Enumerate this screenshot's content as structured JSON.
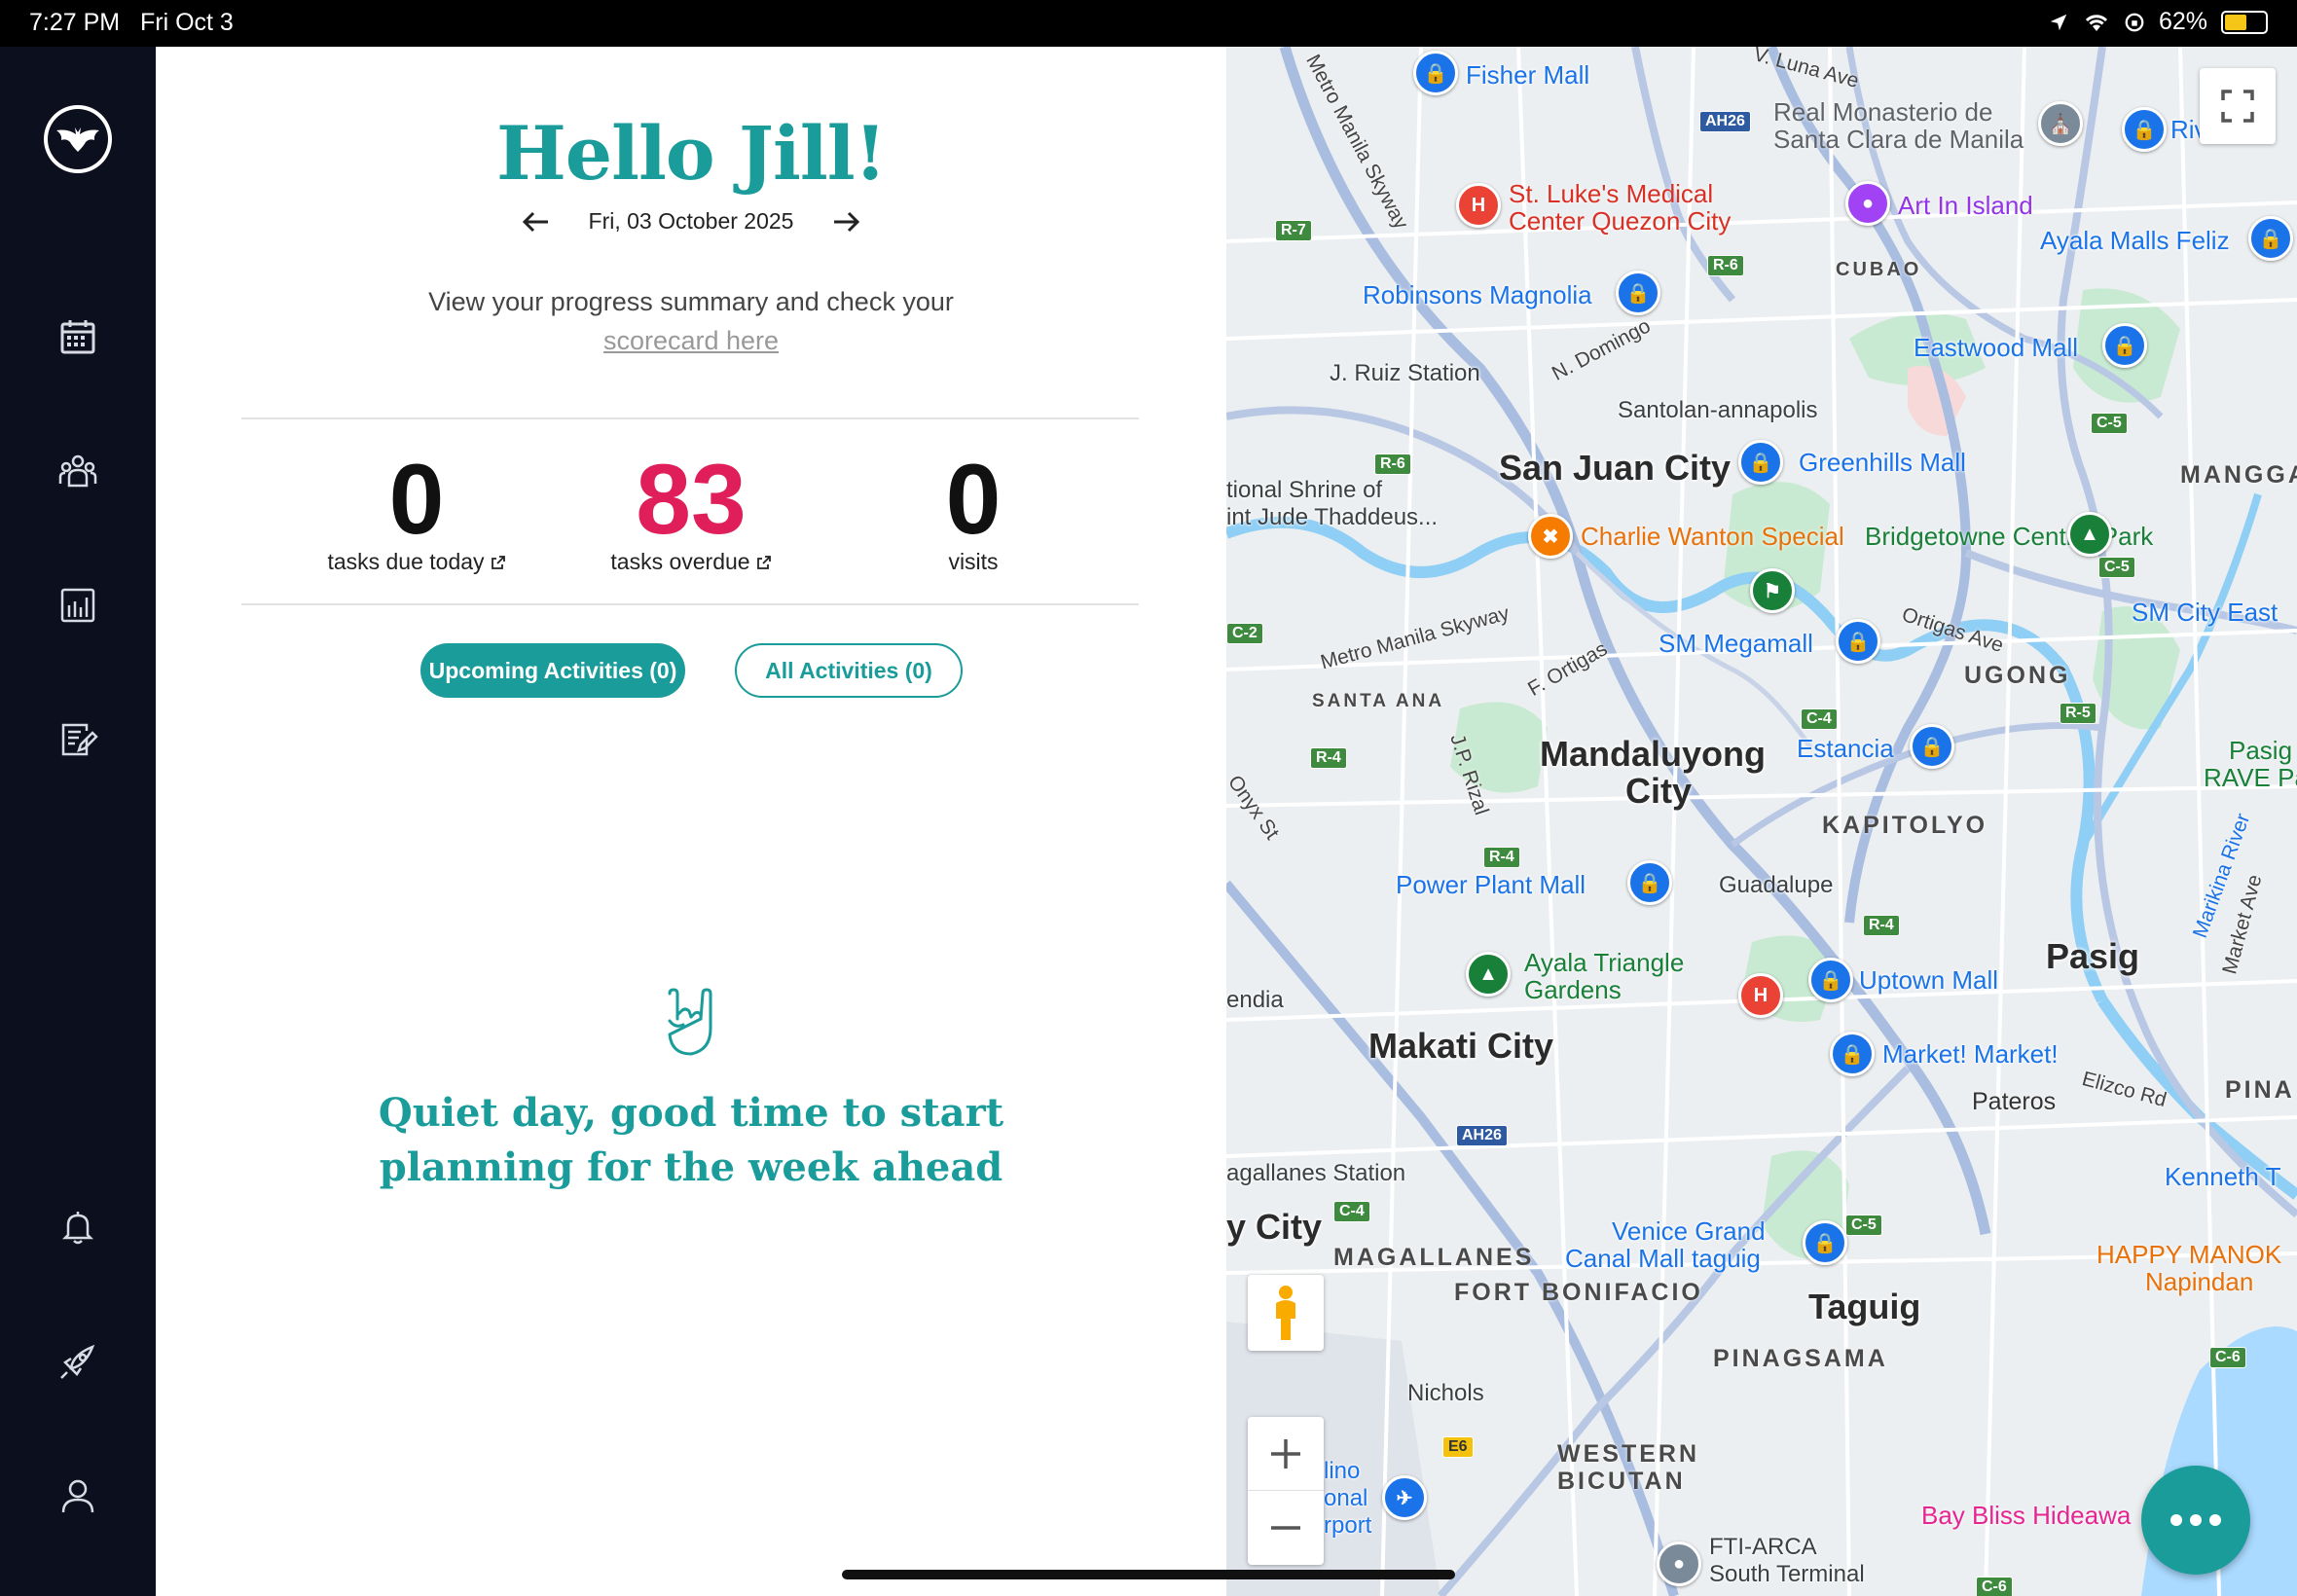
{
  "status_bar": {
    "time": "7:27 PM",
    "date": "Fri Oct 3",
    "battery": "62%",
    "battery_level": 0.62
  },
  "sidebar": {
    "items": [
      {
        "icon": "calendar-icon"
      },
      {
        "icon": "team-icon"
      },
      {
        "icon": "reports-icon"
      },
      {
        "icon": "notes-icon"
      },
      {
        "icon": "bell-icon"
      },
      {
        "icon": "rocket-icon"
      },
      {
        "icon": "profile-icon"
      }
    ]
  },
  "main": {
    "greeting": "Hello Jill!",
    "current_date": "Fri, 03 October 2025",
    "summary_text": "View your progress summary and check your",
    "scorecard_link": "scorecard here",
    "stats": [
      {
        "value": "0",
        "label": "tasks due today",
        "color": "#111111"
      },
      {
        "value": "83",
        "label": "tasks overdue",
        "color": "#e01e5a"
      },
      {
        "value": "0",
        "label": "visits",
        "color": "#111111"
      }
    ],
    "tabs": {
      "upcoming": "Upcoming Activities (0)",
      "all": "All Activities (0)"
    },
    "empty_state": {
      "icon": "rock-hand-icon",
      "line1": "Quiet day, good time to start",
      "line2": "planning for the week ahead"
    }
  },
  "map": {
    "cities": [
      "San Juan City",
      "Mandaluyong",
      "City",
      "Makati City",
      "Pasig",
      "Taguig",
      "y City"
    ],
    "areas": [
      "CUBAO",
      "MANGGA",
      "UGONG",
      "KAPITOLYO",
      "SANTA ANA",
      "MAGALLANES",
      "FORT BONIFACIO",
      "PINAGSAMA",
      "WESTERN",
      "BICUTAN",
      "PINA",
      "Pateros"
    ],
    "pois": {
      "fisher": "Fisher Mall",
      "monasterio1": "Real Monasterio de",
      "monasterio2": "Santa Clara de Manila",
      "stlukes1": "St. Luke's Medical",
      "stlukes2": "Center Quezon City",
      "artisland": "Art In Island",
      "ayalafeliz": "Ayala Malls Feliz",
      "robinsons": "Robinsons Magnolia",
      "eastwood": "Eastwood Mall",
      "jruiz": "J. Ruiz Station",
      "santolan": "Santolan-annapolis",
      "greenhills": "Greenhills Mall",
      "shrine1": "tional Shrine of",
      "shrine2": "int Jude Thaddeus...",
      "charlie": "Charlie Wanton Special",
      "bridgetowne": "Bridgetowne Central Park",
      "smeast": "SM City East",
      "megamall": "SM Megamall",
      "estancia": "Estancia",
      "rave1": "Pasig",
      "rave2": "RAVE Park",
      "powerplant": "Power Plant Mall",
      "guadalupe": "Guadalupe",
      "ayalatri1": "Ayala Triangle",
      "ayalatri2": "Gardens",
      "uptown": "Uptown Mall",
      "market": "Market! Market!",
      "endia": "endia",
      "magallanes": "agallanes Station",
      "venice1": "Venice Grand",
      "venice2": "Canal Mall taguig",
      "kenneth": "Kenneth T",
      "happymanok1": "HAPPY MANOK",
      "happymanok2": "Napindan",
      "nichols": "Nichols",
      "airport1": "lino",
      "airport2": "onal",
      "airport3": "rport",
      "ftiarca1": "FTI-ARCA",
      "ftiarca2": "South Terminal",
      "baybliss": "Bay Bliss Hideawa",
      "riv": "Riv"
    },
    "streets": [
      "V. Luna Ave",
      "N. Domingo",
      "Metro Manila Skyway",
      "F. Ortigas",
      "J.P. Rizal",
      "Ortigas Ave",
      "Onyx St",
      "Marikina River",
      "Market Ave",
      "Elizco Rd",
      "Metro Manila Skyway"
    ],
    "shields": [
      "AH26",
      "R-7",
      "R-6",
      "R-6",
      "C-5",
      "C-5",
      "C-2",
      "R-4",
      "C-4",
      "R-5",
      "R-4",
      "R-4",
      "AH26",
      "C-4",
      "C-5",
      "C-6",
      "E6",
      "C-6"
    ]
  }
}
